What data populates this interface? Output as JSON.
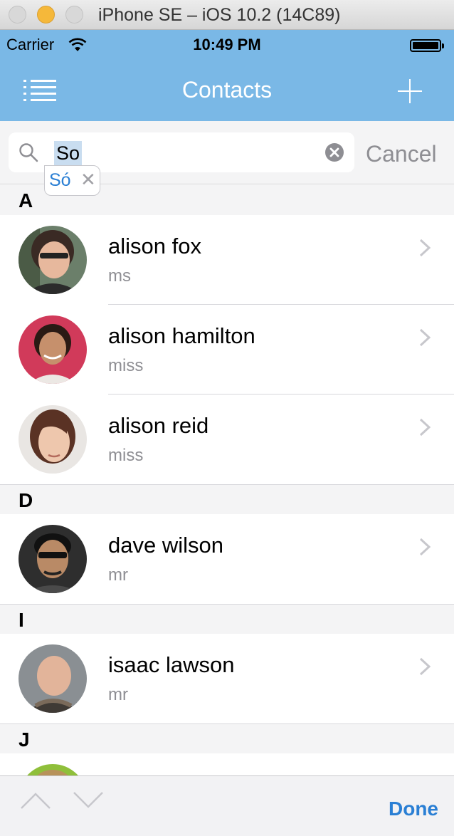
{
  "window": {
    "title": "iPhone SE – iOS 10.2 (14C89)"
  },
  "status": {
    "carrier": "Carrier",
    "time": "10:49 PM"
  },
  "nav": {
    "title": "Contacts"
  },
  "search": {
    "query": "So",
    "cancel_label": "Cancel",
    "suggestion": "Só",
    "suggestion_close": "✕"
  },
  "sections": [
    {
      "letter": "A",
      "contacts": [
        {
          "name": "alison fox",
          "title": "ms"
        },
        {
          "name": "alison hamilton",
          "title": "miss"
        },
        {
          "name": "alison reid",
          "title": "miss"
        }
      ]
    },
    {
      "letter": "D",
      "contacts": [
        {
          "name": "dave wilson",
          "title": "mr"
        }
      ]
    },
    {
      "letter": "I",
      "contacts": [
        {
          "name": "isaac lawson",
          "title": "mr"
        }
      ]
    },
    {
      "letter": "J",
      "contacts": []
    }
  ],
  "accessory": {
    "done_label": "Done"
  },
  "colors": {
    "nav_bg": "#7ab8e6",
    "accent": "#2a7fd4"
  }
}
